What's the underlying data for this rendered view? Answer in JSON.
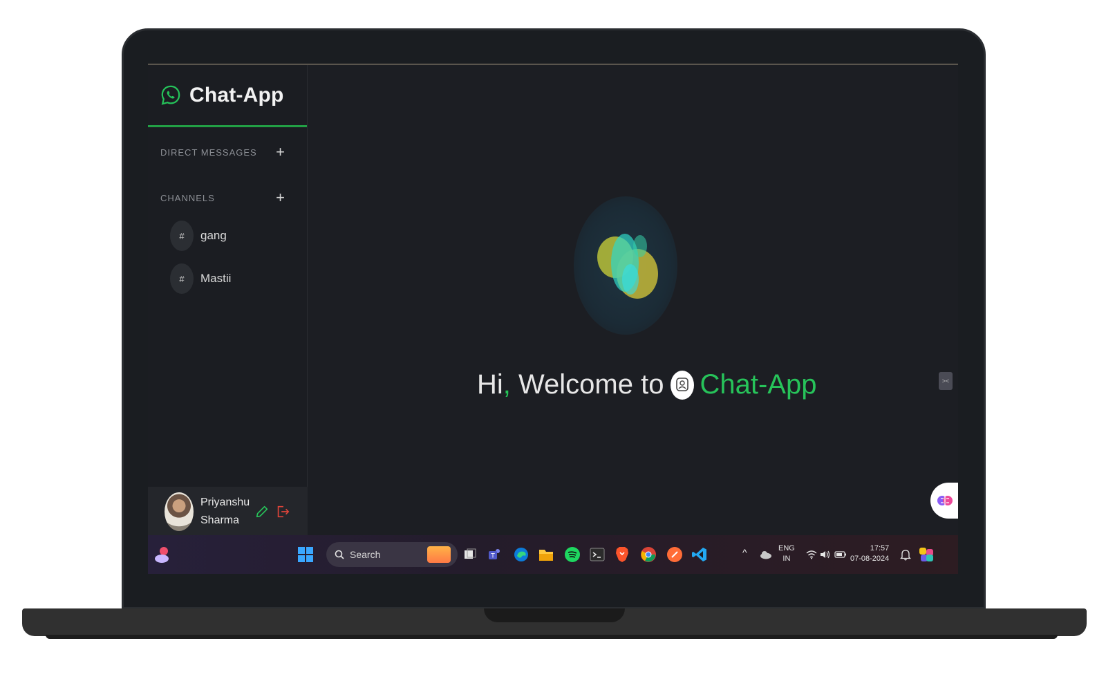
{
  "app": {
    "name": "Chat-App"
  },
  "sidebar": {
    "direct_messages_label": "DIRECT MESSAGES",
    "channels_label": "CHANNELS",
    "add_symbol": "+",
    "channels": [
      {
        "symbol": "#",
        "name": "gang"
      },
      {
        "symbol": "#",
        "name": "Mastii"
      }
    ],
    "profile": {
      "first_name": "Priyanshu",
      "last_name": "Sharma"
    }
  },
  "main": {
    "welcome_prefix": "Hi",
    "welcome_comma": ",",
    "welcome_middle": " Welcome to",
    "welcome_app": "Chat-App"
  },
  "taskbar": {
    "search_placeholder": "Search",
    "language_top": "ENG",
    "language_bottom": "IN",
    "time": "17:57",
    "date": "07-08-2024",
    "chevron": "^"
  },
  "colors": {
    "accent_green": "#27c35a",
    "background": "#1c1e23",
    "sidebar": "#1b1d22",
    "logout_red": "#e0443a"
  },
  "icons": {
    "brand": "whatsapp-icon",
    "edit": "pencil-icon",
    "logout": "logout-icon",
    "float": "brain-icon"
  }
}
